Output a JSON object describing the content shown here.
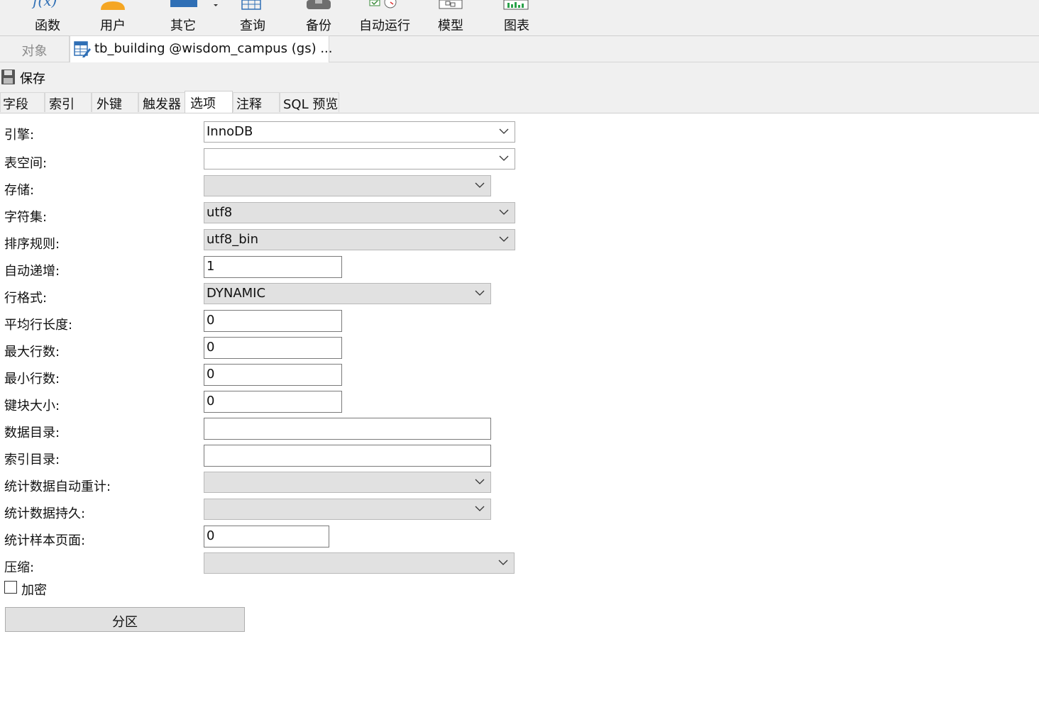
{
  "toolbar": {
    "items": [
      {
        "label": "函数",
        "icon": "function-icon"
      },
      {
        "label": "用户",
        "icon": "user-icon"
      },
      {
        "label": "其它",
        "icon": "other-icon"
      },
      {
        "label": "查询",
        "icon": "query-icon"
      },
      {
        "label": "备份",
        "icon": "backup-icon"
      },
      {
        "label": "自动运行",
        "icon": "autorun-icon"
      },
      {
        "label": "模型",
        "icon": "model-icon"
      },
      {
        "label": "图表",
        "icon": "chart-icon"
      }
    ]
  },
  "tabs": {
    "objects": "对象",
    "table_tab": "tb_building @wisdom_campus (gs) ..."
  },
  "savebar": {
    "save": "保存"
  },
  "subtabs": [
    "字段",
    "索引",
    "外键",
    "触发器",
    "选项",
    "注释",
    "SQL 预览"
  ],
  "active_subtab": "选项",
  "form": {
    "engine": {
      "label": "引擎:",
      "value": "InnoDB"
    },
    "tablespace": {
      "label": "表空间:",
      "value": ""
    },
    "storage": {
      "label": "存储:",
      "value": ""
    },
    "charset": {
      "label": "字符集:",
      "value": "utf8"
    },
    "collation": {
      "label": "排序规则:",
      "value": "utf8_bin"
    },
    "auto_increment": {
      "label": "自动递增:",
      "value": "1"
    },
    "row_format": {
      "label": "行格式:",
      "value": "DYNAMIC"
    },
    "avg_row_length": {
      "label": "平均行长度:",
      "value": "0"
    },
    "max_rows": {
      "label": "最大行数:",
      "value": "0"
    },
    "min_rows": {
      "label": "最小行数:",
      "value": "0"
    },
    "key_block_size": {
      "label": "键块大小:",
      "value": "0"
    },
    "data_directory": {
      "label": "数据目录:",
      "value": ""
    },
    "index_directory": {
      "label": "索引目录:",
      "value": ""
    },
    "stats_auto_recalc": {
      "label": "统计数据自动重计:",
      "value": ""
    },
    "stats_persistent": {
      "label": "统计数据持久:",
      "value": ""
    },
    "stats_sample_pages": {
      "label": "统计样本页面:",
      "value": "0"
    },
    "compression": {
      "label": "压缩:",
      "value": ""
    },
    "encryption": {
      "label": "加密",
      "checked": false
    },
    "partition_button": "分区"
  },
  "colors": {
    "toolbar_bg": "#f0f0f0",
    "accent_blue": "#2f6fb5",
    "user_orange": "#f5a623",
    "combo_disabled": "#e1e1e1"
  }
}
